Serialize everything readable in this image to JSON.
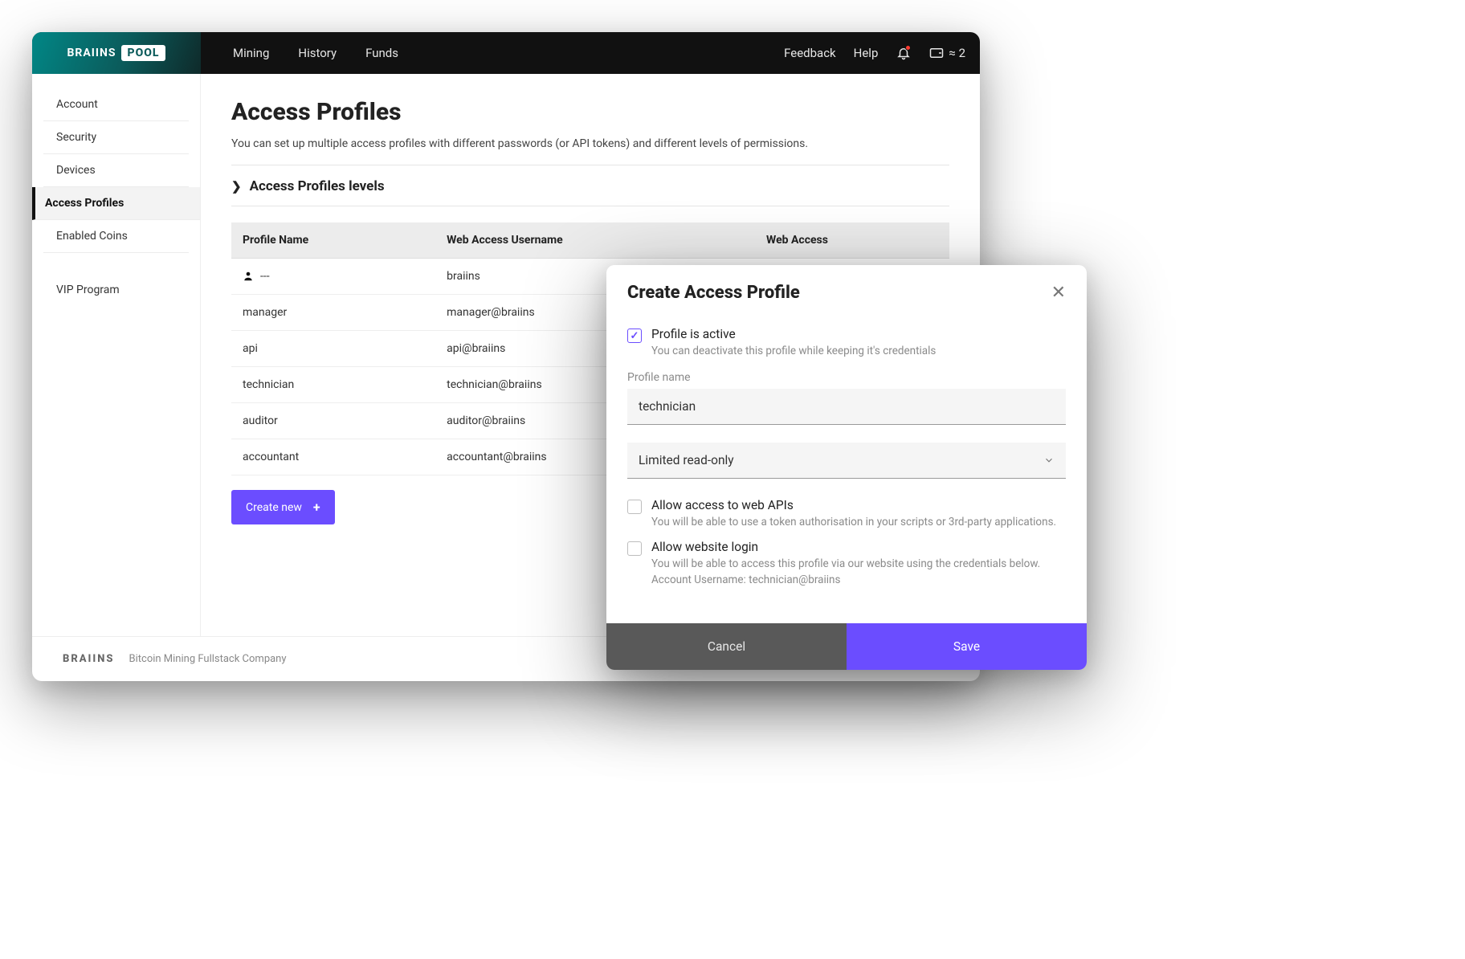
{
  "logo": {
    "part1": "BRAIINS",
    "part2": "POOL"
  },
  "topnav": {
    "mining": "Mining",
    "history": "History",
    "funds": "Funds"
  },
  "toprt": {
    "feedback": "Feedback",
    "help": "Help",
    "wallet_approx": "≈ 2"
  },
  "sidebar": {
    "items": [
      {
        "label": "Account"
      },
      {
        "label": "Security"
      },
      {
        "label": "Devices"
      },
      {
        "label": "Access Profiles"
      },
      {
        "label": "Enabled Coins"
      }
    ],
    "vip": "VIP Program"
  },
  "page": {
    "title": "Access Profiles",
    "subtitle": "You can set up multiple access profiles with different passwords (or API tokens) and different levels of permissions.",
    "levels_toggle": "Access Profiles levels"
  },
  "table": {
    "headers": {
      "name": "Profile Name",
      "username": "Web Access Username",
      "access": "Web Access"
    },
    "rows": [
      {
        "name": "---",
        "username": "braiins",
        "access": true,
        "primary": true
      },
      {
        "name": "manager",
        "username": "manager@braiins",
        "access": true
      },
      {
        "name": "api",
        "username": "api@braiins",
        "access": false
      },
      {
        "name": "technician",
        "username": "technician@braiins",
        "access": true
      },
      {
        "name": "auditor",
        "username": "auditor@braiins",
        "access": true
      },
      {
        "name": "accountant",
        "username": "accountant@braiins",
        "access": true
      }
    ]
  },
  "create_btn": "Create new",
  "footer": {
    "logo": "BRAIINS",
    "tag": "Bitcoin Mining Fullstack Company"
  },
  "modal": {
    "title": "Create Access Profile",
    "active": {
      "label": "Profile is active",
      "desc": "You can deactivate this profile while keeping it's credentials",
      "checked": true
    },
    "name": {
      "label": "Profile name",
      "value": "technician"
    },
    "permission": "Limited read-only",
    "api": {
      "label": "Allow access to web APIs",
      "desc": "You will be able to use a token authorisation in your scripts or 3rd-party applications.",
      "checked": false
    },
    "web": {
      "label": "Allow website login",
      "desc": "You will be able to access this profile via our website using the credentials below.\nAccount Username: technician@braiins",
      "checked": false
    },
    "cancel": "Cancel",
    "save": "Save"
  }
}
